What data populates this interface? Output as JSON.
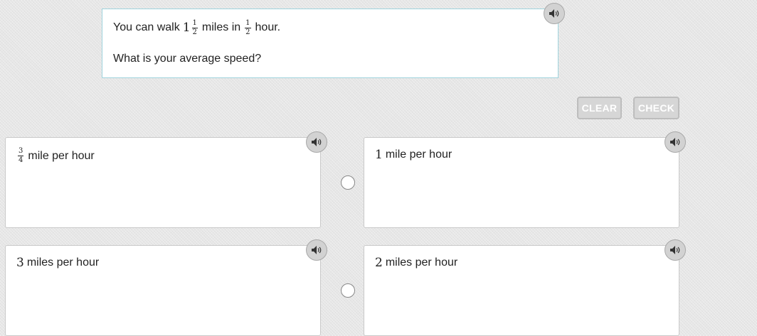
{
  "question": {
    "prefix": "You can walk",
    "distance_whole": "1",
    "distance_num": "1",
    "distance_den": "2",
    "middle": "miles in",
    "time_num": "1",
    "time_den": "2",
    "suffix": "hour.",
    "prompt": "What is your average speed?",
    "audio_icon": "speaker-icon"
  },
  "controls": {
    "clear_label": "CLEAR",
    "check_label": "CHECK"
  },
  "answers": [
    {
      "num": "3",
      "den": "4",
      "label": "mile per hour",
      "audio_icon": "speaker-icon"
    },
    {
      "value": "1",
      "label": "mile per hour",
      "audio_icon": "speaker-icon"
    },
    {
      "value": "3",
      "label": "miles per hour",
      "audio_icon": "speaker-icon"
    },
    {
      "value": "2",
      "label": "miles per hour",
      "audio_icon": "speaker-icon"
    }
  ]
}
